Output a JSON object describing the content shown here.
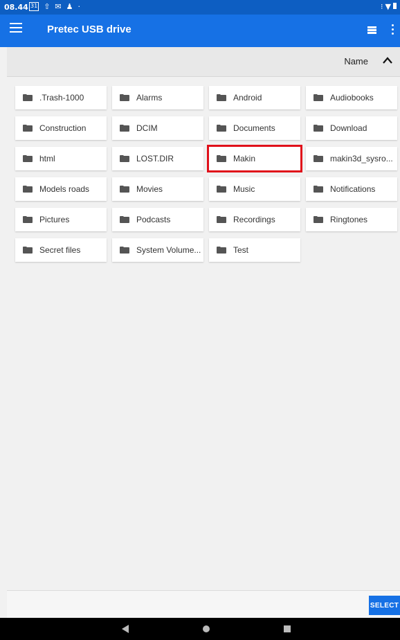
{
  "status_bar": {
    "time": "08.44",
    "icons": [
      "calendar-icon",
      "upload-icon",
      "gmail-icon",
      "person-icon",
      "dot-icon"
    ],
    "calendar_text": "31",
    "right_icons": [
      "vibrate-icon",
      "wifi-icon",
      "battery-icon"
    ]
  },
  "app_bar": {
    "title": "Pretec USB drive"
  },
  "sort_bar": {
    "label": "Name"
  },
  "folders": [
    ".Trash-1000",
    "Alarms",
    "Android",
    "Audiobooks",
    "Construction",
    "DCIM",
    "Documents",
    "Download",
    "html",
    "LOST.DIR",
    "Makin",
    "makin3d_sysro...",
    "Models roads",
    "Movies",
    "Music",
    "Notifications",
    "Pictures",
    "Podcasts",
    "Recordings",
    "Ringtones",
    "Secret files",
    "System Volume...",
    "Test"
  ],
  "highlighted_folder": "Makin",
  "bottom_bar": {
    "select_label": "SELECT"
  },
  "colors": {
    "status_bar": "#0d5ec2",
    "app_bar": "#1671e5",
    "highlight": "#e0101a",
    "folder_icon": "#555555"
  }
}
